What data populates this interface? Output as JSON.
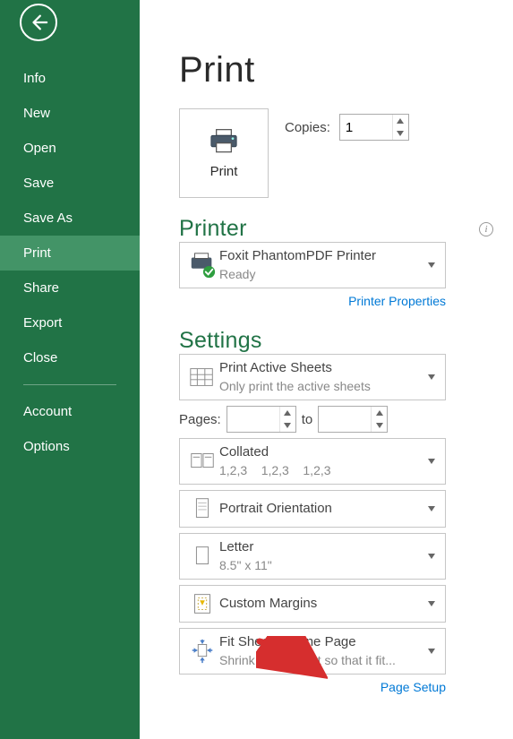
{
  "sidebar": {
    "items": [
      {
        "label": "Info"
      },
      {
        "label": "New"
      },
      {
        "label": "Open"
      },
      {
        "label": "Save"
      },
      {
        "label": "Save As"
      },
      {
        "label": "Print"
      },
      {
        "label": "Share"
      },
      {
        "label": "Export"
      },
      {
        "label": "Close"
      }
    ],
    "selected_index": 5,
    "account_label": "Account",
    "options_label": "Options"
  },
  "page": {
    "title": "Print"
  },
  "print_button": {
    "label": "Print"
  },
  "copies": {
    "label": "Copies:",
    "value": "1"
  },
  "printer_section": {
    "heading": "Printer",
    "selected": {
      "name": "Foxit PhantomPDF Printer",
      "status": "Ready"
    },
    "properties_link": "Printer Properties"
  },
  "settings_section": {
    "heading": "Settings",
    "pages_label": "Pages:",
    "pages_to": "to",
    "pages_from": "",
    "pages_to_value": "",
    "options": {
      "what": {
        "title": "Print Active Sheets",
        "sub": "Only print the active sheets"
      },
      "collate": {
        "title": "Collated",
        "sub": "1,2,3    1,2,3    1,2,3"
      },
      "orient": {
        "title": "Portrait Orientation",
        "sub": ""
      },
      "paper": {
        "title": "Letter",
        "sub": "8.5\" x 11\""
      },
      "margins": {
        "title": "Custom Margins",
        "sub": ""
      },
      "scaling": {
        "title": "Fit Sheet on One Page",
        "sub": "Shrink the printout so that it fit..."
      }
    },
    "page_setup_link": "Page Setup"
  }
}
